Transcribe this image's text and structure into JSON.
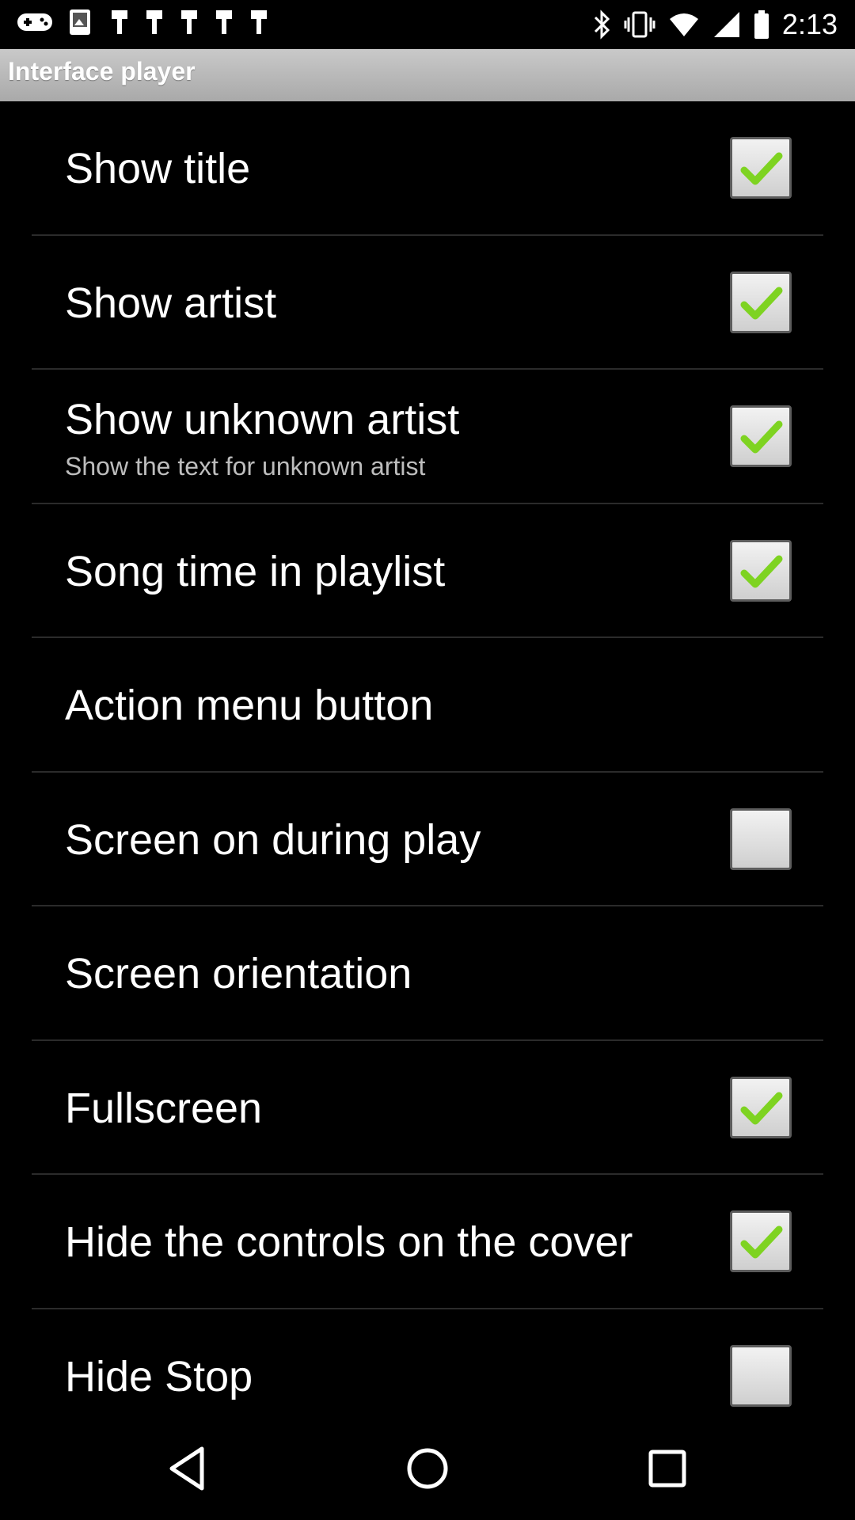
{
  "status_bar": {
    "time": "2:13",
    "left_icons": [
      "gamepad-icon",
      "photo-icon",
      "notification-icon",
      "notification-icon",
      "notification-icon",
      "notification-icon",
      "notification-icon"
    ],
    "right_icons": [
      "bluetooth-icon",
      "vibrate-icon",
      "wifi-icon",
      "signal-icon",
      "battery-icon"
    ]
  },
  "header": {
    "title": "Interface player"
  },
  "settings": [
    {
      "label": "Show title",
      "checkbox": true,
      "checked": true
    },
    {
      "label": "Show artist",
      "checkbox": true,
      "checked": true
    },
    {
      "label": "Show unknown artist",
      "summary": "Show the text for unknown artist",
      "checkbox": true,
      "checked": true
    },
    {
      "label": "Song time in playlist",
      "checkbox": true,
      "checked": true
    },
    {
      "label": "Action menu button",
      "checkbox": false
    },
    {
      "label": "Screen on during play",
      "checkbox": true,
      "checked": false
    },
    {
      "label": "Screen orientation",
      "checkbox": false
    },
    {
      "label": "Fullscreen",
      "checkbox": true,
      "checked": true
    },
    {
      "label": "Hide the controls on the cover",
      "checkbox": true,
      "checked": true
    },
    {
      "label": "Hide Stop",
      "checkbox": true,
      "checked": false
    }
  ],
  "nav_bar": {
    "buttons": [
      "back-icon",
      "home-icon",
      "recents-icon"
    ]
  },
  "colors": {
    "check": "#7ed321",
    "title_bar": "#b5b5b5",
    "divider": "#2b2b2b"
  }
}
